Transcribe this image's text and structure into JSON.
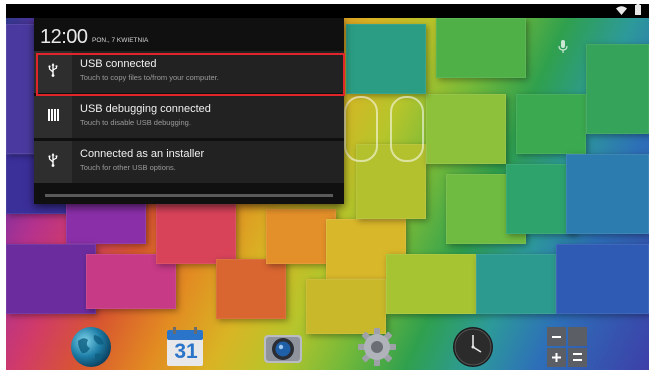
{
  "status_bar": {
    "icons": [
      "wifi-icon",
      "battery-icon"
    ]
  },
  "shade": {
    "time": "12:00",
    "date": "PON., 7 KWIETNIA",
    "notifications": [
      {
        "icon": "usb-icon",
        "title": "USB connected",
        "subtitle": "Touch to copy files to/from your computer.",
        "highlighted": true
      },
      {
        "icon": "usb-debug-icon",
        "title": "USB debugging connected",
        "subtitle": "Touch to disable USB debugging.",
        "highlighted": false
      },
      {
        "icon": "usb-icon",
        "title": "Connected as an installer",
        "subtitle": "Touch for other USB options.",
        "highlighted": false
      }
    ]
  },
  "home": {
    "search_mic": "mic-icon",
    "dock": [
      {
        "icon": "browser-globe-icon"
      },
      {
        "icon": "calendar-icon",
        "label": "31"
      },
      {
        "icon": "camera-icon"
      },
      {
        "icon": "settings-gear-icon"
      },
      {
        "icon": "clock-icon"
      },
      {
        "icon": "calculator-icon"
      }
    ]
  },
  "colors": {
    "highlight": "#e0262a",
    "shade_bg": "#101010",
    "notification_bg": "#222222"
  }
}
